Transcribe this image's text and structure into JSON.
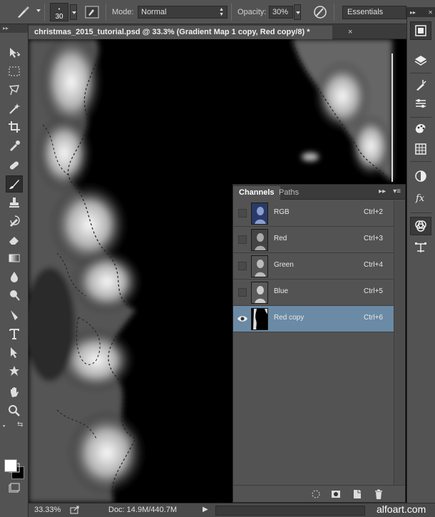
{
  "options_bar": {
    "brush_size": "30",
    "mode_label": "Mode:",
    "mode_value": "Normal",
    "opacity_label": "Opacity:",
    "opacity_value": "30%",
    "workspace": "Essentials"
  },
  "document": {
    "tab_title": "christmas_2015_tutorial.psd @ 33.3% (Gradient Map 1 copy, Red copy/8) *",
    "close": "×"
  },
  "status_bar": {
    "zoom": "33.33%",
    "doc_info": "Doc: 14.9M/440.7M",
    "watermark": "alfoart.com"
  },
  "channels_panel": {
    "tabs": [
      "Channels",
      "Paths"
    ],
    "active_tab": "Channels",
    "channels": [
      {
        "name": "RGB",
        "shortcut": "Ctrl+2",
        "visible": false,
        "selected": false
      },
      {
        "name": "Red",
        "shortcut": "Ctrl+3",
        "visible": false,
        "selected": false
      },
      {
        "name": "Green",
        "shortcut": "Ctrl+4",
        "visible": false,
        "selected": false
      },
      {
        "name": "Blue",
        "shortcut": "Ctrl+5",
        "visible": false,
        "selected": false
      },
      {
        "name": "Red copy",
        "shortcut": "Ctrl+6",
        "visible": true,
        "selected": true
      }
    ]
  },
  "colors": {
    "foreground": "#ffffff",
    "background": "#000000",
    "selected_row": "#6b8aa5"
  }
}
